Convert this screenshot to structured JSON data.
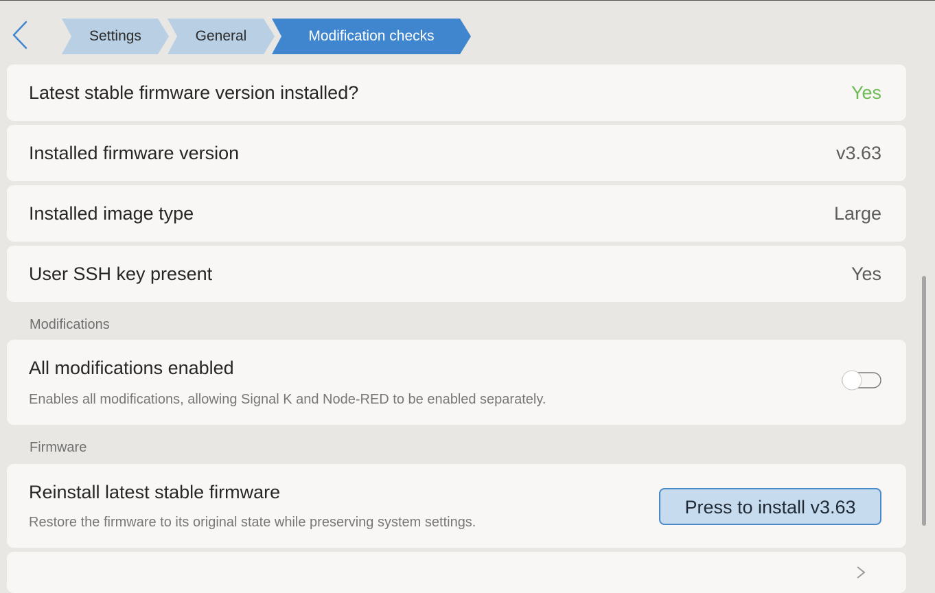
{
  "breadcrumb": {
    "items": [
      {
        "label": "Settings"
      },
      {
        "label": "General"
      },
      {
        "label": "Modification checks"
      }
    ]
  },
  "rows": {
    "latest_stable": {
      "label": "Latest stable firmware version installed?",
      "value": "Yes",
      "value_color": "#6fba57"
    },
    "installed_version": {
      "label": "Installed firmware version",
      "value": "v3.63"
    },
    "image_type": {
      "label": "Installed image type",
      "value": "Large"
    },
    "ssh_key": {
      "label": "User SSH key present",
      "value": "Yes"
    }
  },
  "sections": {
    "modifications": "Modifications",
    "firmware": "Firmware"
  },
  "modifications": {
    "all_enabled": {
      "label": "All modifications enabled",
      "description": "Enables all modifications, allowing Signal K and Node-RED to be enabled separately.",
      "toggle_on": false
    }
  },
  "firmware": {
    "reinstall": {
      "label": "Reinstall latest stable firmware",
      "description": "Restore the firmware to its original state while preserving system settings.",
      "button_label": "Press to install v3.63"
    }
  },
  "icons": {
    "back": "chevron-left-icon",
    "next": "chevron-right-icon"
  },
  "colors": {
    "accent": "#4a8ac7",
    "breadcrumb_inactive": "#b9cfe3",
    "breadcrumb_active": "#3f86cf",
    "background": "#e8e7e4",
    "row_background": "#f8f7f5"
  }
}
